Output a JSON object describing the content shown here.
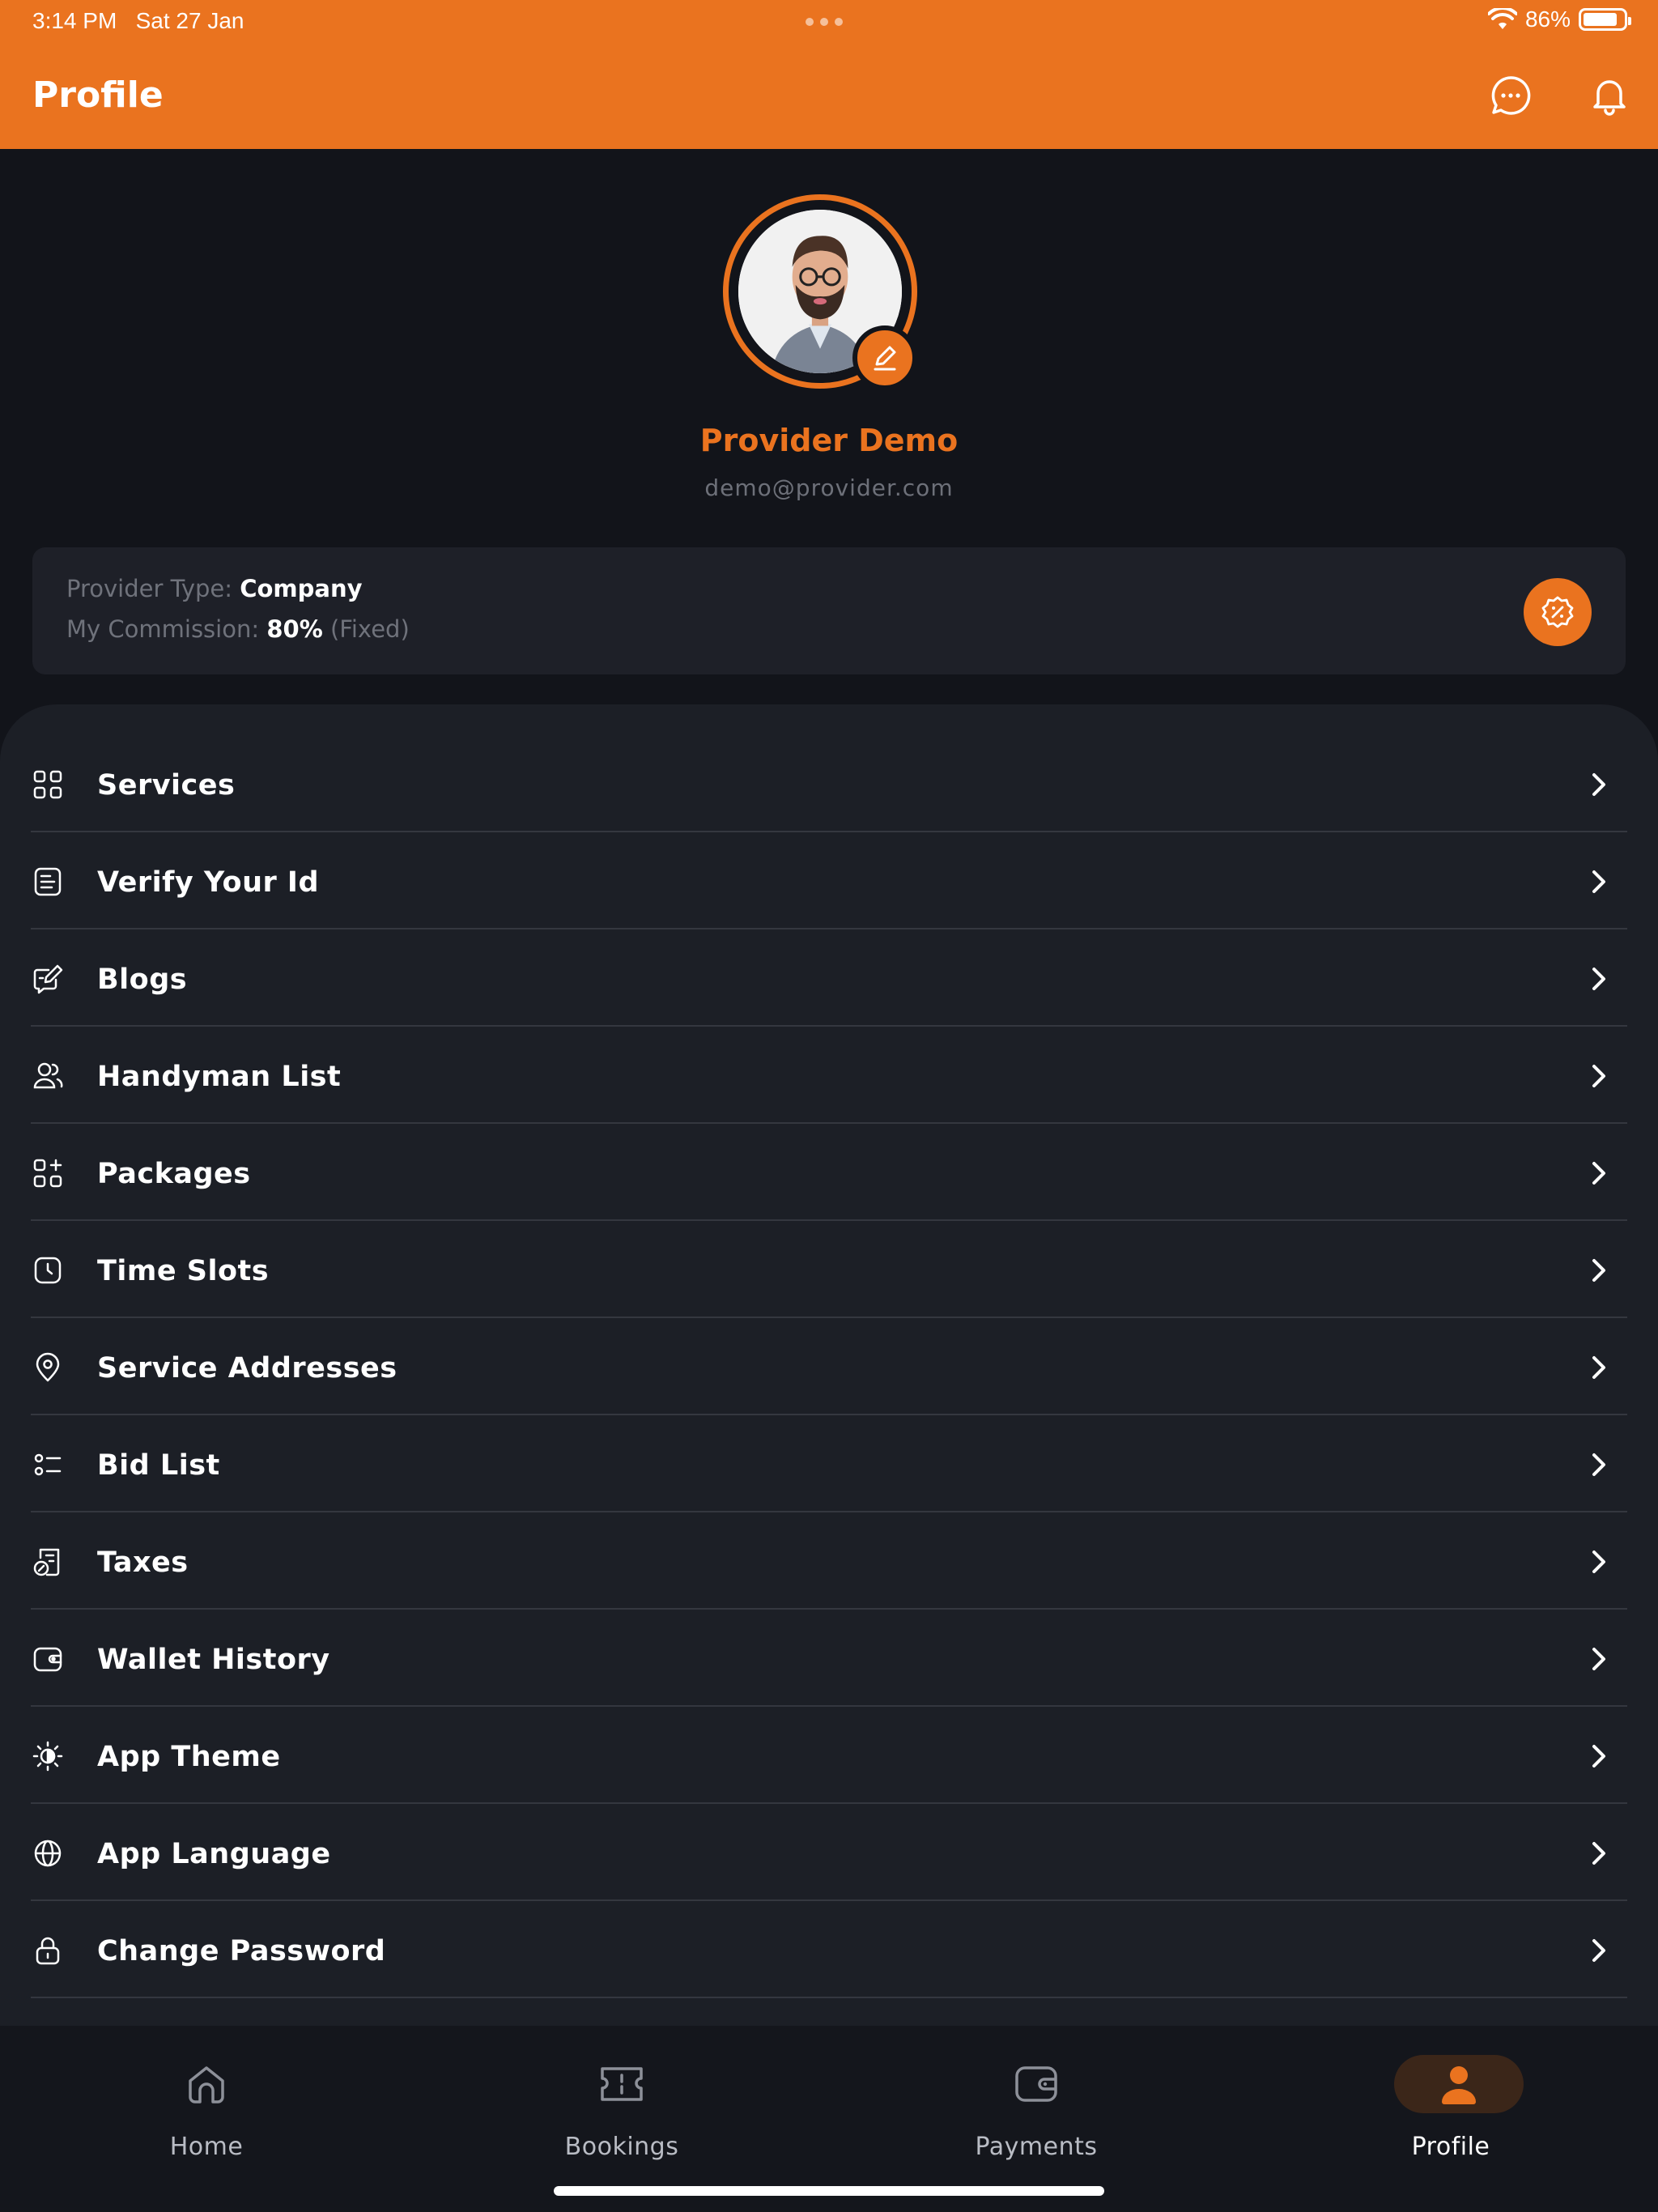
{
  "status_bar": {
    "time": "3:14 PM",
    "date": "Sat 27 Jan",
    "battery": "86%",
    "battery_level": 0.86
  },
  "header": {
    "title": "Profile",
    "icons": [
      "chat-icon",
      "bell-icon"
    ]
  },
  "profile": {
    "name": "Provider Demo",
    "email": "demo@provider.com"
  },
  "info": {
    "provider_type_label": "Provider Type: ",
    "provider_type_value": "Company",
    "commission_label": "My Commission: ",
    "commission_value": "80%",
    "commission_note": " (Fixed)"
  },
  "menu": [
    {
      "label": "Services",
      "icon": "grid-icon"
    },
    {
      "label": "Verify Your Id",
      "icon": "id-document-icon"
    },
    {
      "label": "Blogs",
      "icon": "edit-note-icon"
    },
    {
      "label": "Handyman List",
      "icon": "users-icon"
    },
    {
      "label": "Packages",
      "icon": "package-grid-icon"
    },
    {
      "label": "Time Slots",
      "icon": "clock-icon"
    },
    {
      "label": "Service Addresses",
      "icon": "location-pin-icon"
    },
    {
      "label": "Bid List",
      "icon": "list-icon"
    },
    {
      "label": "Taxes",
      "icon": "tax-icon"
    },
    {
      "label": "Wallet History",
      "icon": "wallet-icon"
    },
    {
      "label": "App Theme",
      "icon": "theme-icon"
    },
    {
      "label": "App Language",
      "icon": "globe-icon"
    },
    {
      "label": "Change Password",
      "icon": "lock-icon"
    }
  ],
  "bottom_nav": [
    {
      "label": "Home",
      "icon": "home-icon",
      "active": false
    },
    {
      "label": "Bookings",
      "icon": "ticket-icon",
      "active": false
    },
    {
      "label": "Payments",
      "icon": "wallet-icon",
      "active": false
    },
    {
      "label": "Profile",
      "icon": "person-icon",
      "active": true
    }
  ],
  "colors": {
    "accent": "#ea731f",
    "background": "#12141a",
    "surface": "#1c1f26"
  }
}
